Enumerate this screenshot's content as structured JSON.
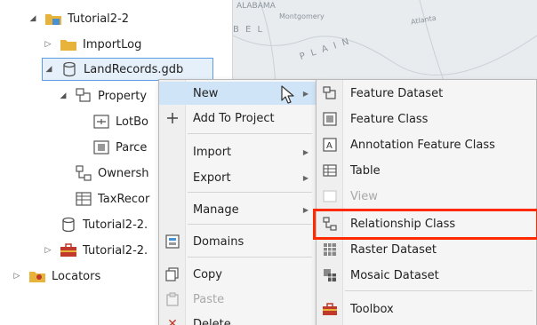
{
  "tree": {
    "items": [
      {
        "label": "Tutorial2-2"
      },
      {
        "label": "ImportLog"
      },
      {
        "label": "LandRecords.gdb"
      },
      {
        "label": "Property"
      },
      {
        "label": "LotBo"
      },
      {
        "label": "Parce"
      },
      {
        "label": "Ownersh"
      },
      {
        "label": "TaxRecor"
      },
      {
        "label": "Tutorial2-2."
      },
      {
        "label": "Tutorial2-2."
      },
      {
        "label": "Locators"
      }
    ]
  },
  "map": {
    "labels": [
      "ALABAMA",
      "Montgomery",
      "B E L",
      "P L A I N",
      "Atlanta"
    ]
  },
  "context_menu": {
    "items": [
      {
        "label": "New"
      },
      {
        "label": "Add To Project"
      },
      {
        "label": "Import"
      },
      {
        "label": "Export"
      },
      {
        "label": "Manage"
      },
      {
        "label": "Domains"
      },
      {
        "label": "Copy"
      },
      {
        "label": "Paste"
      },
      {
        "label": "Delete"
      }
    ]
  },
  "submenu": {
    "items": [
      {
        "label": "Feature Dataset"
      },
      {
        "label": "Feature Class"
      },
      {
        "label": "Annotation Feature Class"
      },
      {
        "label": "Table"
      },
      {
        "label": "View"
      },
      {
        "label": "Relationship Class"
      },
      {
        "label": "Raster Dataset"
      },
      {
        "label": "Mosaic Dataset"
      },
      {
        "label": "Toolbox"
      }
    ]
  },
  "colors": {
    "highlight": "#ff2a00",
    "selection": "#5a9de0",
    "hover": "#cfe4f7",
    "folder": "#e8b33a"
  }
}
